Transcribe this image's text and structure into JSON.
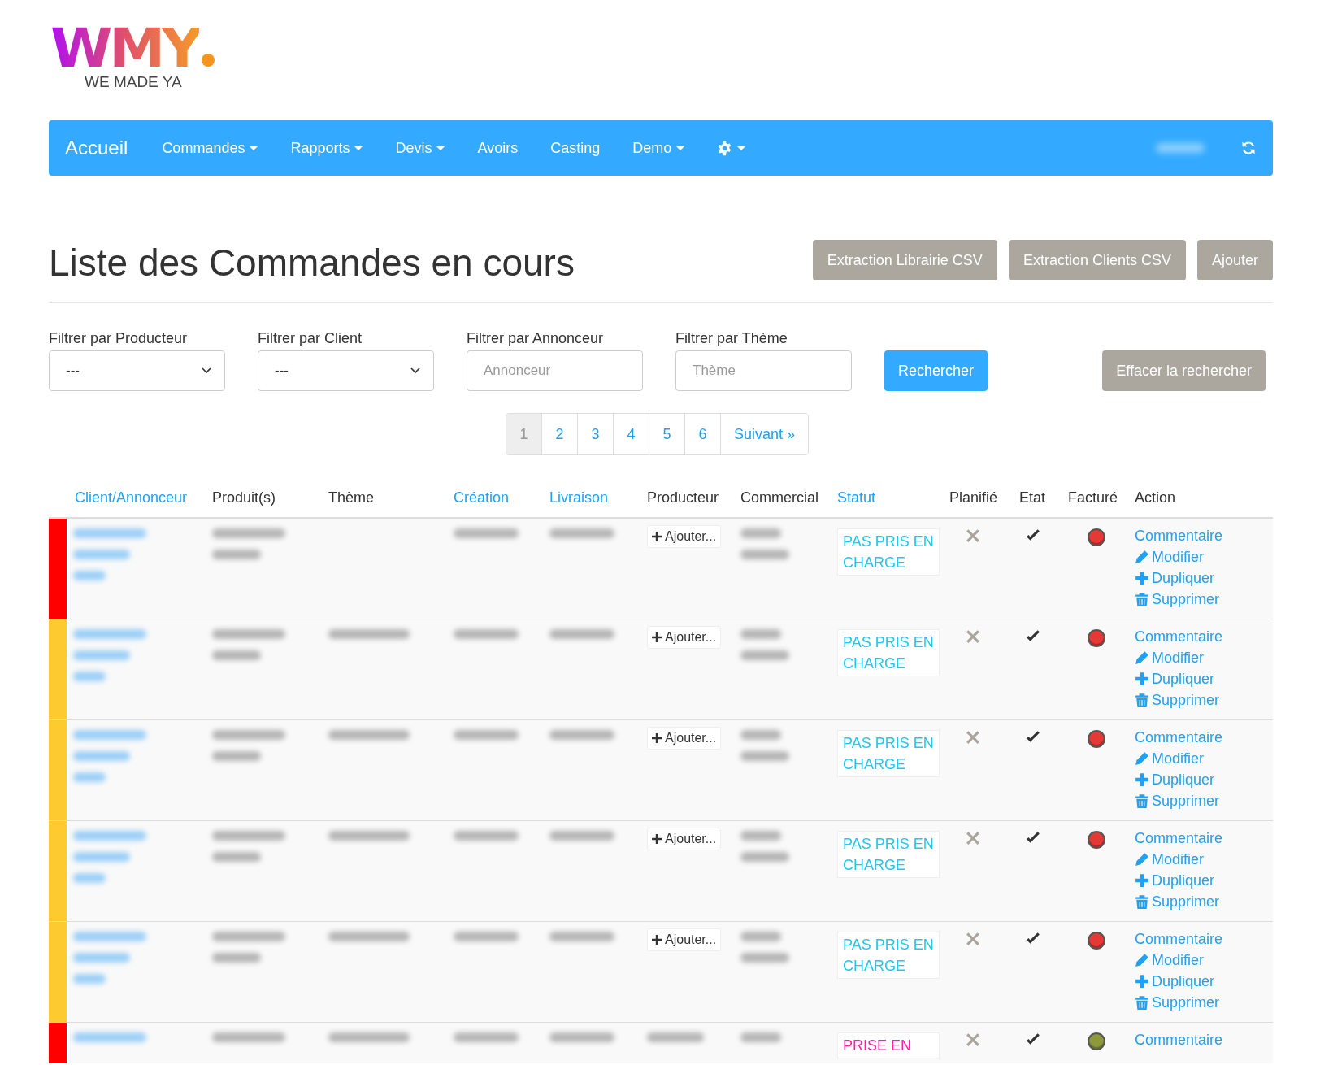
{
  "logo": {
    "mark": "WMY",
    "tagline": "WE MADE YA"
  },
  "nav": {
    "brand": "Accueil",
    "items": [
      {
        "kind": "text",
        "label": "Commandes",
        "dropdown": true
      },
      {
        "kind": "text",
        "label": "Rapports",
        "dropdown": true
      },
      {
        "kind": "text",
        "label": "Devis",
        "dropdown": true
      },
      {
        "kind": "text",
        "label": "Avoirs",
        "dropdown": false
      },
      {
        "kind": "text",
        "label": "Casting",
        "dropdown": false
      },
      {
        "kind": "text",
        "label": "Demo",
        "dropdown": true
      },
      {
        "kind": "gear",
        "dropdown": true
      }
    ]
  },
  "page": {
    "title": "Liste des Commandes en cours",
    "buttons": [
      "Extraction Librairie CSV",
      "Extraction Clients CSV",
      "Ajouter"
    ]
  },
  "filters": [
    {
      "kind": "select",
      "label": "Filtrer par Producteur",
      "value": "---"
    },
    {
      "kind": "select",
      "label": "Filtrer par Client",
      "value": "---"
    },
    {
      "kind": "text",
      "label": "Filtrer par Annonceur",
      "placeholder": "Annonceur"
    },
    {
      "kind": "text",
      "label": "Filtrer par Thème",
      "placeholder": "Thème"
    }
  ],
  "search_button": "Rechercher",
  "clear_button": "Effacer la rechercher",
  "pagination": {
    "pages": [
      {
        "label": "1",
        "selected": true
      },
      {
        "label": "2",
        "selected": false
      },
      {
        "label": "3",
        "selected": false
      },
      {
        "label": "4",
        "selected": false
      },
      {
        "label": "5",
        "selected": false
      },
      {
        "label": "6",
        "selected": false
      }
    ],
    "next": "Suivant »"
  },
  "table": {
    "columns": [
      {
        "label": "Client/Annonceur",
        "sortable": true
      },
      {
        "label": "Produit(s)",
        "sortable": false
      },
      {
        "label": "Thème",
        "sortable": false
      },
      {
        "label": "Création",
        "sortable": true
      },
      {
        "label": "Livraison",
        "sortable": true
      },
      {
        "label": "Producteur",
        "sortable": false
      },
      {
        "label": "Commercial",
        "sortable": false
      },
      {
        "label": "Statut",
        "sortable": true
      },
      {
        "label": "Planifié",
        "sortable": false
      },
      {
        "label": "Etat",
        "sortable": false
      },
      {
        "label": "Facturé",
        "sortable": false
      },
      {
        "label": "Action",
        "sortable": false
      }
    ],
    "rows": [
      {
        "color": "#ff0000",
        "has_theme": false,
        "producer_action": "Ajouter...",
        "status": "PAS PRIS EN CHARGE",
        "status_taken": false,
        "planned": false,
        "state_ok": true,
        "invoiced": false,
        "actions": [
          {
            "kind": "comment",
            "label": "Commentaire"
          },
          {
            "kind": "edit",
            "label": "Modifier"
          },
          {
            "kind": "duplicate",
            "label": "Dupliquer"
          },
          {
            "kind": "delete",
            "label": "Supprimer"
          }
        ]
      },
      {
        "color": "#fdca2f",
        "has_theme": true,
        "producer_action": "Ajouter...",
        "status": "PAS PRIS EN CHARGE",
        "status_taken": false,
        "planned": false,
        "state_ok": true,
        "invoiced": false,
        "actions": [
          {
            "kind": "comment",
            "label": "Commentaire"
          },
          {
            "kind": "edit",
            "label": "Modifier"
          },
          {
            "kind": "duplicate",
            "label": "Dupliquer"
          },
          {
            "kind": "delete",
            "label": "Supprimer"
          }
        ]
      },
      {
        "color": "#fdca2f",
        "has_theme": true,
        "producer_action": "Ajouter...",
        "status": "PAS PRIS EN CHARGE",
        "status_taken": false,
        "planned": false,
        "state_ok": true,
        "invoiced": false,
        "actions": [
          {
            "kind": "comment",
            "label": "Commentaire"
          },
          {
            "kind": "edit",
            "label": "Modifier"
          },
          {
            "kind": "duplicate",
            "label": "Dupliquer"
          },
          {
            "kind": "delete",
            "label": "Supprimer"
          }
        ]
      },
      {
        "color": "#fdca2f",
        "has_theme": true,
        "producer_action": "Ajouter...",
        "status": "PAS PRIS EN CHARGE",
        "status_taken": false,
        "planned": false,
        "state_ok": true,
        "invoiced": false,
        "actions": [
          {
            "kind": "comment",
            "label": "Commentaire"
          },
          {
            "kind": "edit",
            "label": "Modifier"
          },
          {
            "kind": "duplicate",
            "label": "Dupliquer"
          },
          {
            "kind": "delete",
            "label": "Supprimer"
          }
        ]
      },
      {
        "color": "#fdca2f",
        "has_theme": true,
        "producer_action": "Ajouter...",
        "status": "PAS PRIS EN CHARGE",
        "status_taken": false,
        "planned": false,
        "state_ok": true,
        "invoiced": false,
        "actions": [
          {
            "kind": "comment",
            "label": "Commentaire"
          },
          {
            "kind": "edit",
            "label": "Modifier"
          },
          {
            "kind": "duplicate",
            "label": "Dupliquer"
          },
          {
            "kind": "delete",
            "label": "Supprimer"
          }
        ]
      },
      {
        "color": "#ff0000",
        "has_theme": true,
        "status": "PRISE EN",
        "status_taken": true,
        "planned": false,
        "state_ok": true,
        "invoiced": true,
        "actions": [
          {
            "kind": "comment",
            "label": "Commentaire"
          }
        ]
      }
    ]
  }
}
